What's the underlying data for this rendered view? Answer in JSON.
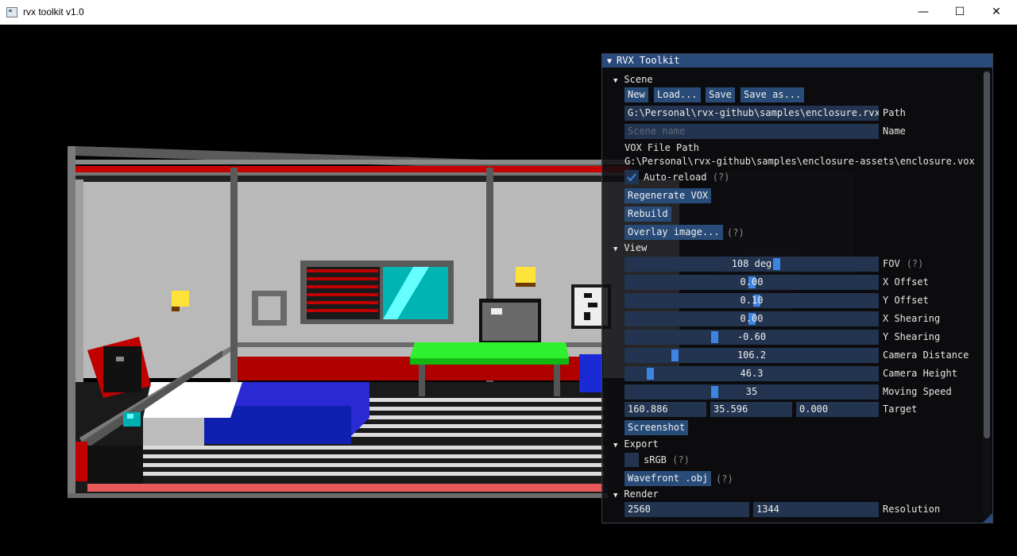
{
  "window": {
    "title": "rvx toolkit v1.0",
    "minimize_glyph": "—",
    "maximize_glyph": "☐",
    "close_glyph": "✕"
  },
  "panel": {
    "title": "RVX Toolkit",
    "scene": {
      "header": "Scene",
      "buttons": {
        "new": "New",
        "load": "Load...",
        "save": "Save",
        "save_as": "Save as..."
      },
      "path_value": "G:\\Personal\\rvx-github\\samples\\enclosure.rvx",
      "path_label": "Path",
      "name_placeholder": "Scene name",
      "name_label": "Name",
      "vox_label": "VOX File Path",
      "vox_path": "G:\\Personal\\rvx-github\\samples\\enclosure-assets\\enclosure.vox",
      "auto_reload_label": "Auto-reload",
      "auto_reload_checked": true,
      "help": "(?)",
      "regenerate": "Regenerate VOX",
      "rebuild": "Rebuild",
      "overlay": "Overlay image..."
    },
    "view": {
      "header": "View",
      "sliders": [
        {
          "label": "FOV",
          "value": "108 deg",
          "fraction": 0.6,
          "help": true
        },
        {
          "label": "X Offset",
          "value": "0.00",
          "fraction": 0.5
        },
        {
          "label": "Y Offset",
          "value": "0.10",
          "fraction": 0.52
        },
        {
          "label": "X Shearing",
          "value": "0.00",
          "fraction": 0.5
        },
        {
          "label": "Y Shearing",
          "value": "-0.60",
          "fraction": 0.35
        },
        {
          "label": "Camera Distance",
          "value": "106.2",
          "fraction": 0.19
        },
        {
          "label": "Camera Height",
          "value": "46.3",
          "fraction": 0.09
        },
        {
          "label": "Moving Speed",
          "value": "35",
          "fraction": 0.35
        }
      ],
      "target": {
        "x": "160.886",
        "y": "35.596",
        "z": "0.000",
        "label": "Target"
      },
      "screenshot": "Screenshot"
    },
    "export": {
      "header": "Export",
      "srgb_label": "sRGB",
      "srgb_checked": false,
      "wavefront": "Wavefront .obj"
    },
    "render": {
      "header": "Render",
      "width": "2560",
      "height": "1344",
      "resolution_label": "Resolution"
    }
  }
}
